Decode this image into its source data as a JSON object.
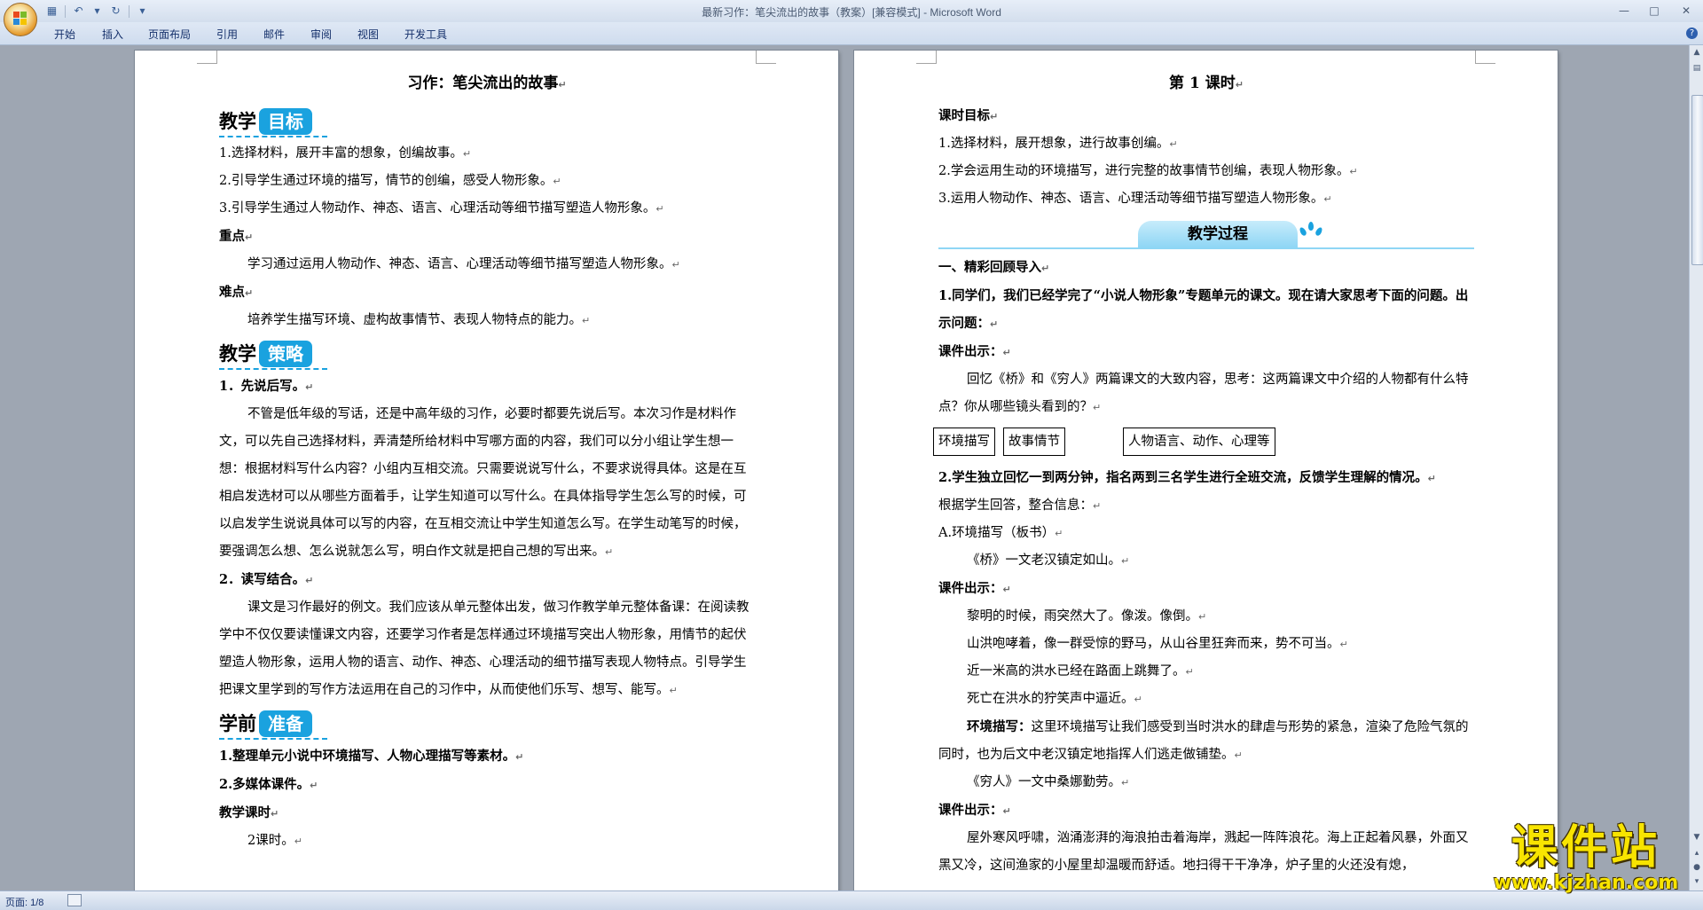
{
  "window": {
    "title": "最新习作：笔尖流出的故事（教案）[兼容模式] - Microsoft Word"
  },
  "ribbon": {
    "tabs": [
      "开始",
      "插入",
      "页面布局",
      "引用",
      "邮件",
      "审阅",
      "视图",
      "开发工具"
    ]
  },
  "status": {
    "page": "页面: 1/8"
  },
  "page_left": {
    "title": "习作：笔尖流出的故事",
    "goal_dark": "教学",
    "goal_pill": "目标",
    "goals": [
      "1.选择材料，展开丰富的想象，创编故事。",
      "2.引导学生通过环境的描写，情节的创编，感受人物形象。",
      "3.引导学生通过人物动作、神态、语言、心理活动等细节描写塑造人物形象。"
    ],
    "key_label": "重点",
    "key_text": "学习通过运用人物动作、神态、语言、心理活动等细节描写塑造人物形象。",
    "diff_label": "难点",
    "diff_text": "培养学生描写环境、虚构故事情节、表现人物特点的能力。",
    "strategy_dark": "教学",
    "strategy_pill": "策略",
    "s1_title": "1．先说后写。",
    "s1_body": "不管是低年级的写话，还是中高年级的习作，必要时都要先说后写。本次习作是材料作文，可以先自己选择材料，弄清楚所给材料中写哪方面的内容，我们可以分小组让学生想一想：根据材料写什么内容？小组内互相交流。只需要说说写什么，不要求说得具体。这是在互相启发选材可以从哪些方面着手，让学生知道可以写什么。在具体指导学生怎么写的时候，可以启发学生说说具体可以写的内容，在互相交流让中学生知道怎么写。在学生动笔写的时候，要强调怎么想、怎么说就怎么写，明白作文就是把自己想的写出来。",
    "s2_title": "2．读写结合。",
    "s2_body": "课文是习作最好的例文。我们应该从单元整体出发，做习作教学单元整体备课：在阅读教学中不仅仅要读懂课文内容，还要学习作者是怎样通过环境描写突出人物形象，用情节的起伏塑造人物形象，运用人物的语言、动作、神态、心理活动的细节描写表现人物特点。引导学生把课文里学到的写作方法运用在自己的习作中，从而使他们乐写、想写、能写。",
    "prep_dark": "学前",
    "prep_pill": "准备",
    "prep1": "1.整理单元小说中环境描写、人物心理描写等素材。",
    "prep2": "2.多媒体课件。",
    "hours_label": "教学课时",
    "hours_value": "2课时。"
  },
  "page_right": {
    "title": "第 1 课时",
    "goal_label": "课时目标",
    "goals": [
      "1.选择材料，展开想象，进行故事创编。",
      "2.学会运用生动的环境描写，进行完整的故事情节创编，表现人物形象。",
      "3.运用人物动作、神态、语言、心理活动等细节描写塑造人物形象。"
    ],
    "process_banner": "教学过程",
    "part1": "一、精彩回顾导入",
    "q1": "1.同学们，我们已经学完了“小说人物形象”专题单元的课文。现在请大家思考下面的问题。出示问题：",
    "courseware1": "课件出示：",
    "recall": "回忆《桥》和《穷人》两篇课文的大致内容，思考：这两篇课文中介绍的人物都有什么特点？你从哪些镜头看到的？",
    "box1": "环境描写",
    "box2": "故事情节",
    "box3": "人物语言、动作、心理等",
    "q2": "2.学生独立回忆一到两分钟，指名两到三名学生进行全班交流，反馈学生理解的情况。",
    "summary": "根据学生回答，整合信息：",
    "a_title": "A.环境描写（板书）",
    "bridge": "《桥》一文老汉镇定如山。",
    "courseware2": "课件出示：",
    "quotes": [
      "黎明的时候，雨突然大了。像泼。像倒。",
      "山洪咆哮着，像一群受惊的野马，从山谷里狂奔而来，势不可当。",
      "近一米高的洪水已经在路面上跳舞了。",
      "死亡在洪水的狞笑声中逼近。"
    ],
    "env_label": "环境描写：",
    "env_text": "这里环境描写让我们感受到当时洪水的肆虐与形势的紧急，渲染了危险气氛的同时，也为后文中老汉镇定地指挥人们逃走做铺垫。",
    "poor": "《穷人》一文中桑娜勤劳。",
    "courseware3": "课件出示：",
    "last": "屋外寒风呼啸，汹涌澎湃的海浪拍击着海岸，溅起一阵阵浪花。海上正起着风暴，外面又黑又冷，这间渔家的小屋里却温暖而舒适。地扫得干干净净，炉子里的火还没有熄，"
  },
  "watermark": {
    "main": "课件站",
    "sub": "www.kjzhan.com"
  }
}
